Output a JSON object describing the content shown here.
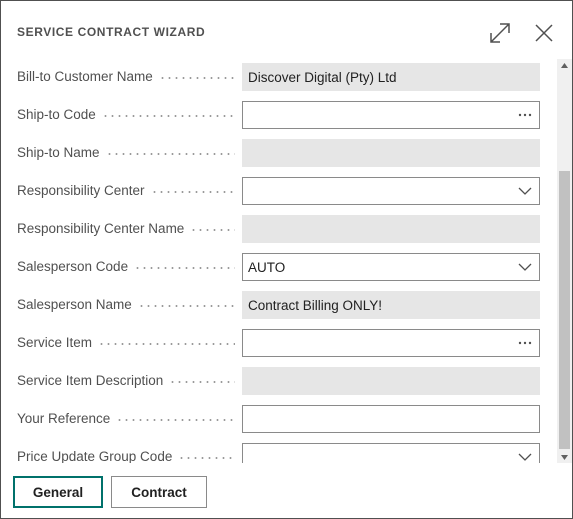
{
  "dialog": {
    "title": "SERVICE CONTRACT WIZARD",
    "expand_icon": "expand-icon",
    "close_icon": "close-icon"
  },
  "fields": [
    {
      "label": "Bill-to Customer Name",
      "value": "Discover Digital (Pty) Ltd",
      "kind": "readonly"
    },
    {
      "label": "Ship-to Code",
      "value": "",
      "kind": "lookup"
    },
    {
      "label": "Ship-to Name",
      "value": "",
      "kind": "readonly"
    },
    {
      "label": "Responsibility Center",
      "value": "",
      "kind": "dropdown"
    },
    {
      "label": "Responsibility Center Name",
      "value": "",
      "kind": "readonly"
    },
    {
      "label": "Salesperson Code",
      "value": "AUTO",
      "kind": "dropdown"
    },
    {
      "label": "Salesperson Name",
      "value": "Contract Billing ONLY!",
      "kind": "readonly"
    },
    {
      "label": "Service Item",
      "value": "",
      "kind": "lookup"
    },
    {
      "label": "Service Item Description",
      "value": "",
      "kind": "readonly"
    },
    {
      "label": "Your Reference",
      "value": "",
      "kind": "text"
    },
    {
      "label": "Price Update Group Code",
      "value": "",
      "kind": "dropdown"
    }
  ],
  "footer": {
    "general_label": "General",
    "contract_label": "Contract"
  },
  "colors": {
    "readonly_field": "#e6e6e6",
    "active_button_border": "#00716b"
  }
}
